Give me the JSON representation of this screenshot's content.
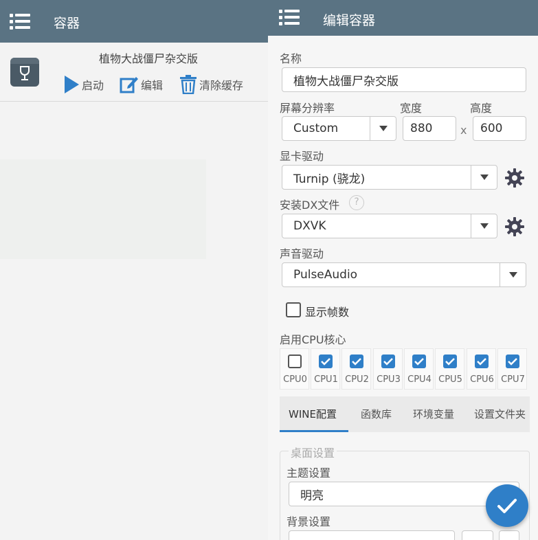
{
  "left": {
    "title": "容器",
    "container_name": "植物大战僵尸杂交版",
    "actions": {
      "start": "启动",
      "edit": "编辑",
      "clear_cache": "清除缓存"
    }
  },
  "editor": {
    "title": "编辑容器",
    "name_label": "名称",
    "name_value": "植物大战僵尸杂交版",
    "resolution_label": "屏幕分辨率",
    "width_label": "宽度",
    "height_label": "高度",
    "resolution_value": "Custom",
    "width_value": "880",
    "times": "x",
    "height_value": "600",
    "gpu_label": "显卡驱动",
    "gpu_value": "Turnip (骁龙)",
    "dx_label": "安装DX文件",
    "dx_help": "?",
    "dx_value": "DXVK",
    "audio_label": "声音驱动",
    "audio_value": "PulseAudio",
    "show_fps_label": "显示帧数",
    "show_fps_checked": false,
    "cpu_label": "启用CPU核心",
    "cpus": [
      {
        "label": "CPU0",
        "checked": false
      },
      {
        "label": "CPU1",
        "checked": true
      },
      {
        "label": "CPU2",
        "checked": true
      },
      {
        "label": "CPU3",
        "checked": true
      },
      {
        "label": "CPU4",
        "checked": true
      },
      {
        "label": "CPU5",
        "checked": true
      },
      {
        "label": "CPU6",
        "checked": true
      },
      {
        "label": "CPU7",
        "checked": true
      }
    ],
    "tabs": [
      "WINE配置",
      "函数库",
      "环境变量",
      "设置文件夹"
    ],
    "active_tab": "WINE配置",
    "desktop_legend": "桌面设置",
    "theme_label": "主题设置",
    "theme_value": "明亮",
    "background_label": "背景设置"
  },
  "colors": {
    "topbar": "#5a7383",
    "accent": "#2f7fc8"
  }
}
